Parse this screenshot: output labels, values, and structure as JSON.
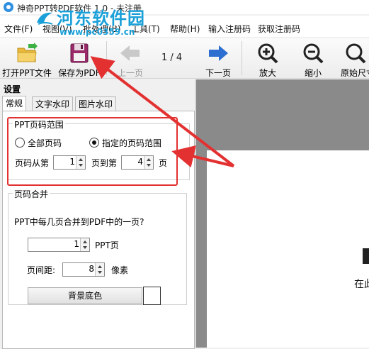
{
  "window": {
    "title": "神奇PPT转PDF软件 1.0 - 未注册"
  },
  "menu": {
    "items": [
      "文件(F)",
      "视图(V)",
      "批处理(B)",
      "工具(T)",
      "帮助(H)",
      "输入注册码",
      "获取注册码"
    ]
  },
  "watermark": {
    "name": "河东软件园",
    "url": "www.pc0359.cn"
  },
  "toolbar": {
    "open_label": "打开PPT文件",
    "save_label": "保存为PDF",
    "prev_label": "上一页",
    "page_indicator": "1 / 4",
    "next_label": "下一页",
    "zoom_in_label": "放大",
    "zoom_out_label": "缩小",
    "original_label": "原始尺寸"
  },
  "settings": {
    "title": "设置",
    "tabs": [
      "常规",
      "文字水印",
      "图片水印"
    ],
    "page_range": {
      "title": "PPT页码范围",
      "option_all": "全部页码",
      "option_specified": "指定的页码范围",
      "selected": "指定的页码范围",
      "from_label": "页码从第",
      "from_value": "1",
      "to_label": "页到第",
      "to_value": "4",
      "suffix": "页"
    },
    "merge": {
      "title": "页码合并",
      "question": "PPT中每几页合并到PDF中的一页?",
      "pages_value": "1",
      "pages_unit": "PPT页",
      "gap_label": "页间距:",
      "gap_value": "8",
      "gap_unit": "像素",
      "bg_button": "背景底色",
      "bg_color": "#ffffff"
    }
  },
  "preview": {
    "partial_text": "在此"
  },
  "colors": {
    "highlight": "#e33030",
    "watermark": "#1aa0d8"
  }
}
